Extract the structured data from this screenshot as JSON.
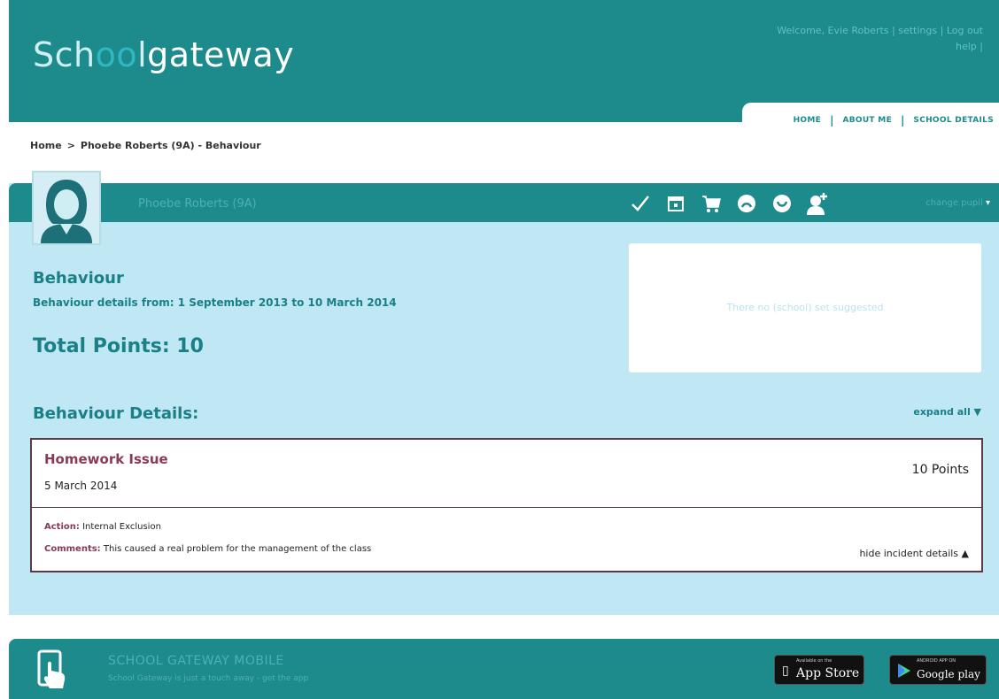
{
  "header": {
    "logo": {
      "pre": "Sch",
      "oo": "oo",
      "post": "l",
      "gateway": "gateway"
    },
    "top_links": {
      "welcome": "Welcome, Evie Roberts",
      "settings": "settings",
      "logout": "Log out",
      "help": "help"
    },
    "nav_tabs": [
      "HOME",
      "ABOUT ME",
      "SCHOOL DETAILS"
    ]
  },
  "breadcrumb": {
    "home": "Home",
    "separator": ">",
    "current": "Phoebe Roberts (9A) - Behaviour"
  },
  "student_bar": {
    "name": "Phoebe Roberts (9A)",
    "select_label": "change pupil",
    "icons": [
      "check-icon",
      "calendar-icon",
      "cart-icon",
      "sad-face-icon",
      "happy-face-icon",
      "add-user-icon"
    ]
  },
  "behaviour": {
    "title": "Behaviour",
    "range": "Behaviour details from: 1 September 2013 to 10 March 2014",
    "total_points": "Total Points: 10",
    "side_box_text": "There no (school) set suggested",
    "details_title": "Behaviour Details:",
    "expand_all": "expand all ▼"
  },
  "incident": {
    "title": "Homework Issue",
    "date": "5 March 2014",
    "points": "10 Points",
    "action_label": "Action:",
    "action_value": "Internal Exclusion",
    "comments_label": "Comments:",
    "comments_value": "This caused a real problem for the management of the class",
    "hide_details": "hide incident details ▲"
  },
  "footer": {
    "title": "SCHOOL GATEWAY MOBILE",
    "subtitle": "School Gateway is just a touch away - get the app",
    "apple_small": "Available on the",
    "apple_big": "App Store",
    "google_small": "ANDROID APP ON",
    "google_big": "Google play"
  },
  "colors": {
    "primary": "#1d8a8c",
    "panel": "#bfe8f4",
    "heading": "#1a7f86",
    "incident_title": "#8a3a52"
  }
}
